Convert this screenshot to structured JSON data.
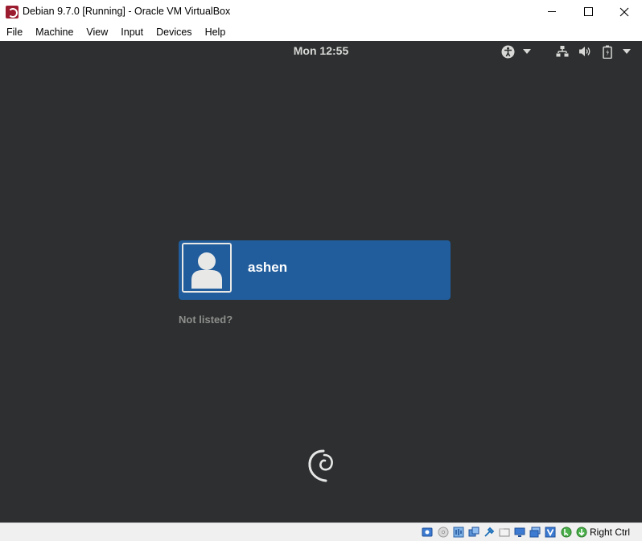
{
  "window": {
    "title": "Debian 9.7.0 [Running] - Oracle VM VirtualBox",
    "icon": "virtualbox-app-icon",
    "controls": [
      "minimize-icon",
      "maximize-icon",
      "close-icon"
    ]
  },
  "menubar": {
    "items": [
      {
        "label": "File"
      },
      {
        "label": "Machine"
      },
      {
        "label": "View"
      },
      {
        "label": "Input"
      },
      {
        "label": "Devices"
      },
      {
        "label": "Help"
      }
    ]
  },
  "guest": {
    "topbar": {
      "clock": "Mon 12:55",
      "tray_icons": [
        "accessibility-icon",
        "chevron-down-icon",
        "network-icon",
        "volume-icon",
        "battery-icon",
        "chevron-down-icon"
      ]
    },
    "login": {
      "username": "ashen",
      "not_listed": "Not listed?"
    },
    "colors": {
      "background": "#2d2f30",
      "selected_user": "#215d9c",
      "text": "#d8d9d6"
    }
  },
  "statusbar": {
    "icons": [
      "hard-disk-icon",
      "optical-drive-icon",
      "audio-icon",
      "network-adapter-icon",
      "usb-icon",
      "shared-folders-icon",
      "display-icon",
      "video-capture-icon",
      "vt-x-icon",
      "mouse-integration-icon",
      "keyboard-capture-icon"
    ],
    "host_key": "Right Ctrl"
  }
}
